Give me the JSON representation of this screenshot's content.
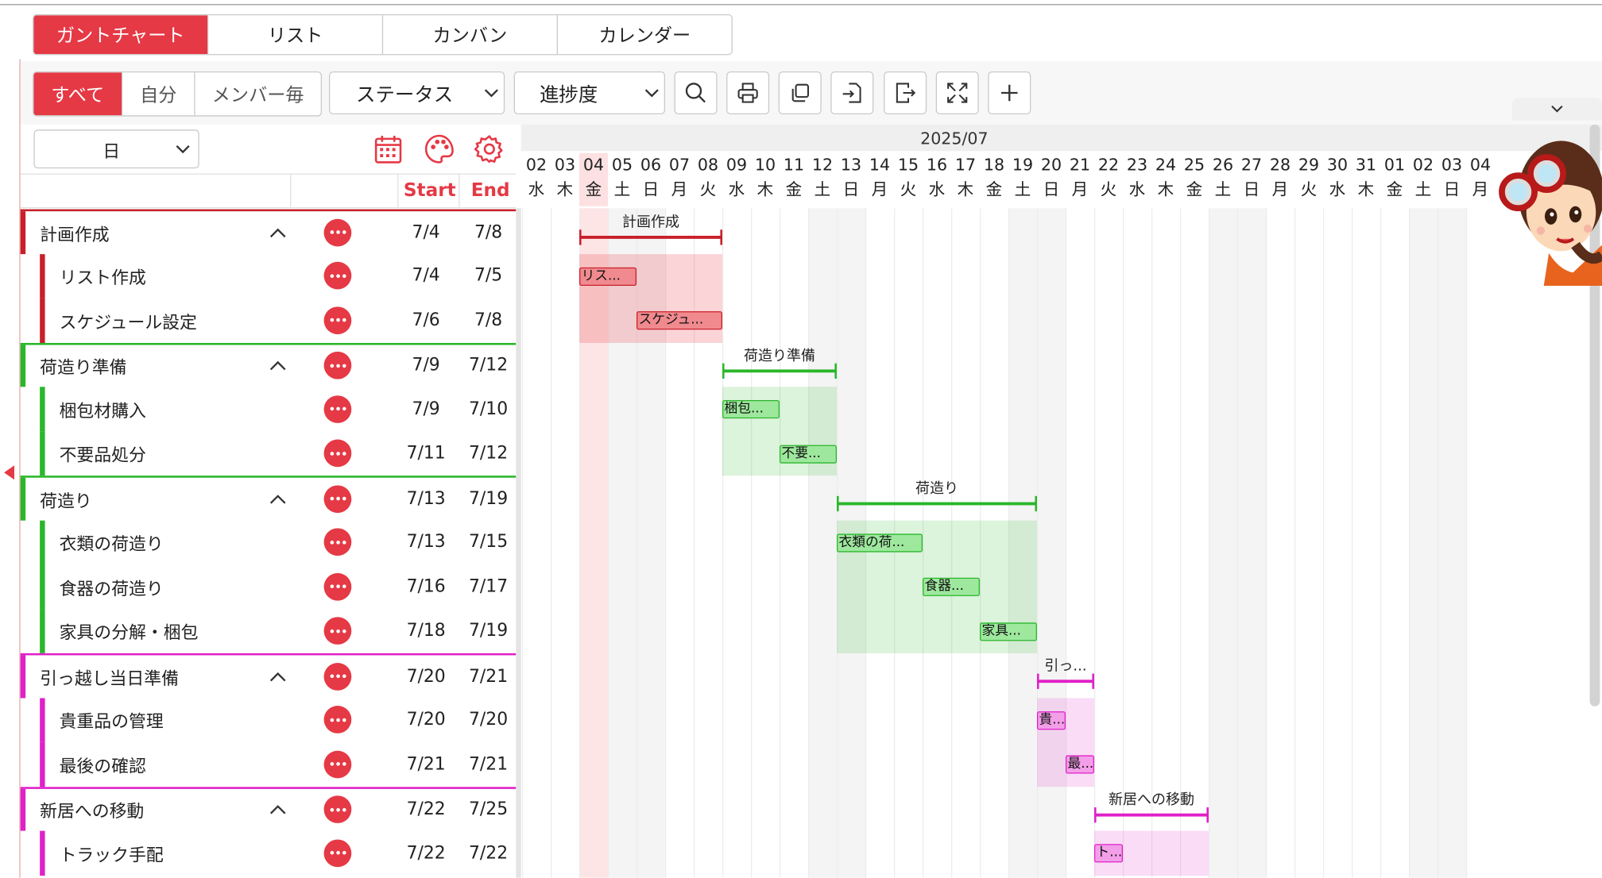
{
  "views": {
    "tabs": [
      "ガントチャート",
      "リスト",
      "カンバン",
      "カレンダー"
    ],
    "active": 0
  },
  "filter": {
    "members": [
      "すべて",
      "自分",
      "メンバー毎"
    ],
    "status_select": "ステータス",
    "progress_select": "進捗度"
  },
  "unit_select": "日",
  "columns": {
    "start": "Start",
    "end": "End"
  },
  "colors": {
    "accent": "#e53945",
    "red": "#c8202a",
    "green": "#2ab72a",
    "magenta": "#e020c8"
  },
  "icons": [
    "calendar-icon",
    "palette-icon",
    "gear-icon",
    "search-icon",
    "print-icon",
    "copy-icon",
    "import-icon",
    "export-icon",
    "fullscreen-icon",
    "plus-icon"
  ],
  "timeline": {
    "month": "2025/07",
    "days": [
      "02",
      "03",
      "04",
      "05",
      "06",
      "07",
      "08",
      "09",
      "10",
      "11",
      "12",
      "13",
      "14",
      "15",
      "16",
      "17",
      "18",
      "19",
      "20",
      "21",
      "22",
      "23",
      "24",
      "25",
      "26",
      "27",
      "28",
      "29",
      "30",
      "31",
      "01",
      "02",
      "03",
      "04"
    ],
    "weekdays": [
      "水",
      "木",
      "金",
      "土",
      "日",
      "月",
      "火",
      "水",
      "木",
      "金",
      "土",
      "日",
      "月",
      "火",
      "水",
      "木",
      "金",
      "土",
      "日",
      "月",
      "火",
      "水",
      "木",
      "金",
      "土",
      "日",
      "月",
      "火",
      "水",
      "木",
      "金",
      "土",
      "日",
      "月"
    ],
    "today_index": 2
  },
  "tasks": [
    {
      "type": "group",
      "name": "計画作成",
      "start": "7/4",
      "end": "7/8",
      "color": "red",
      "bar_label": "計画作成"
    },
    {
      "type": "task",
      "name": "リスト作成",
      "start": "7/4",
      "end": "7/5",
      "color": "red",
      "bar_label": "リス..."
    },
    {
      "type": "task",
      "name": "スケジュール設定",
      "start": "7/6",
      "end": "7/8",
      "color": "red",
      "bar_label": "スケジュ..."
    },
    {
      "type": "group",
      "name": "荷造り準備",
      "start": "7/9",
      "end": "7/12",
      "color": "green",
      "bar_label": "荷造り準備"
    },
    {
      "type": "task",
      "name": "梱包材購入",
      "start": "7/9",
      "end": "7/10",
      "color": "green",
      "bar_label": "梱包..."
    },
    {
      "type": "task",
      "name": "不要品処分",
      "start": "7/11",
      "end": "7/12",
      "color": "green",
      "bar_label": "不要..."
    },
    {
      "type": "group",
      "name": "荷造り",
      "start": "7/13",
      "end": "7/19",
      "color": "green",
      "bar_label": "荷造り"
    },
    {
      "type": "task",
      "name": "衣類の荷造り",
      "start": "7/13",
      "end": "7/15",
      "color": "green",
      "bar_label": "衣類の荷..."
    },
    {
      "type": "task",
      "name": "食器の荷造り",
      "start": "7/16",
      "end": "7/17",
      "color": "green",
      "bar_label": "食器..."
    },
    {
      "type": "task",
      "name": "家具の分解・梱包",
      "start": "7/18",
      "end": "7/19",
      "color": "green",
      "bar_label": "家具..."
    },
    {
      "type": "group",
      "name": "引っ越し当日準備",
      "start": "7/20",
      "end": "7/21",
      "color": "magenta",
      "bar_label": "引っ..."
    },
    {
      "type": "task",
      "name": "貴重品の管理",
      "start": "7/20",
      "end": "7/20",
      "color": "magenta",
      "bar_label": "貴..."
    },
    {
      "type": "task",
      "name": "最後の確認",
      "start": "7/21",
      "end": "7/21",
      "color": "magenta",
      "bar_label": "最..."
    },
    {
      "type": "group",
      "name": "新居への移動",
      "start": "7/22",
      "end": "7/25",
      "color": "magenta",
      "bar_label": "新居への移動"
    },
    {
      "type": "task",
      "name": "トラック手配",
      "start": "7/22",
      "end": "7/22",
      "color": "magenta",
      "bar_label": "ト..."
    }
  ]
}
